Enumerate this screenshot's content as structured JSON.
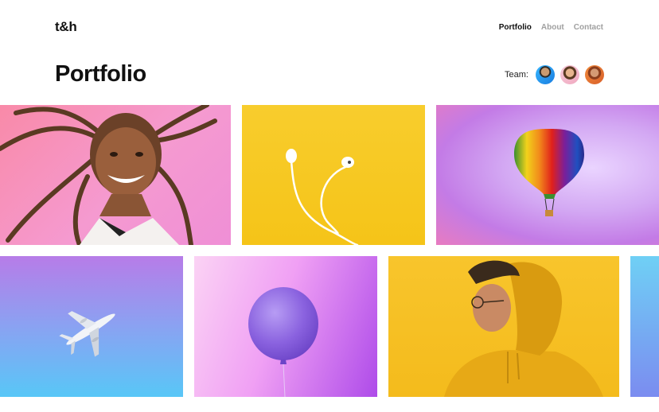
{
  "header": {
    "logo": "t&h",
    "nav": [
      {
        "label": "Portfolio",
        "active": true
      },
      {
        "label": "About",
        "active": false
      },
      {
        "label": "Contact",
        "active": false
      }
    ]
  },
  "page": {
    "title": "Portfolio",
    "team_label": "Team:",
    "team_avatars": [
      "avatar-1",
      "avatar-2",
      "avatar-3"
    ]
  },
  "gallery": {
    "tiles": [
      {
        "subject": "smiling woman with braids",
        "background": "#f59ad0"
      },
      {
        "subject": "white earphones",
        "background": "#f8cd2d"
      },
      {
        "subject": "hot air balloon",
        "background": "#d3a8f3"
      },
      {
        "subject": "airplane",
        "background": "#8aa2f2"
      },
      {
        "subject": "purple balloon",
        "background": "#f0a0f4"
      },
      {
        "subject": "man in yellow hoodie",
        "background": "#f8c52c"
      },
      {
        "subject": "blue gradient",
        "background": "#6fd0f5"
      }
    ]
  },
  "colors": {
    "text": "#111111",
    "nav_inactive": "#a0a0a0",
    "background": "#ffffff"
  }
}
